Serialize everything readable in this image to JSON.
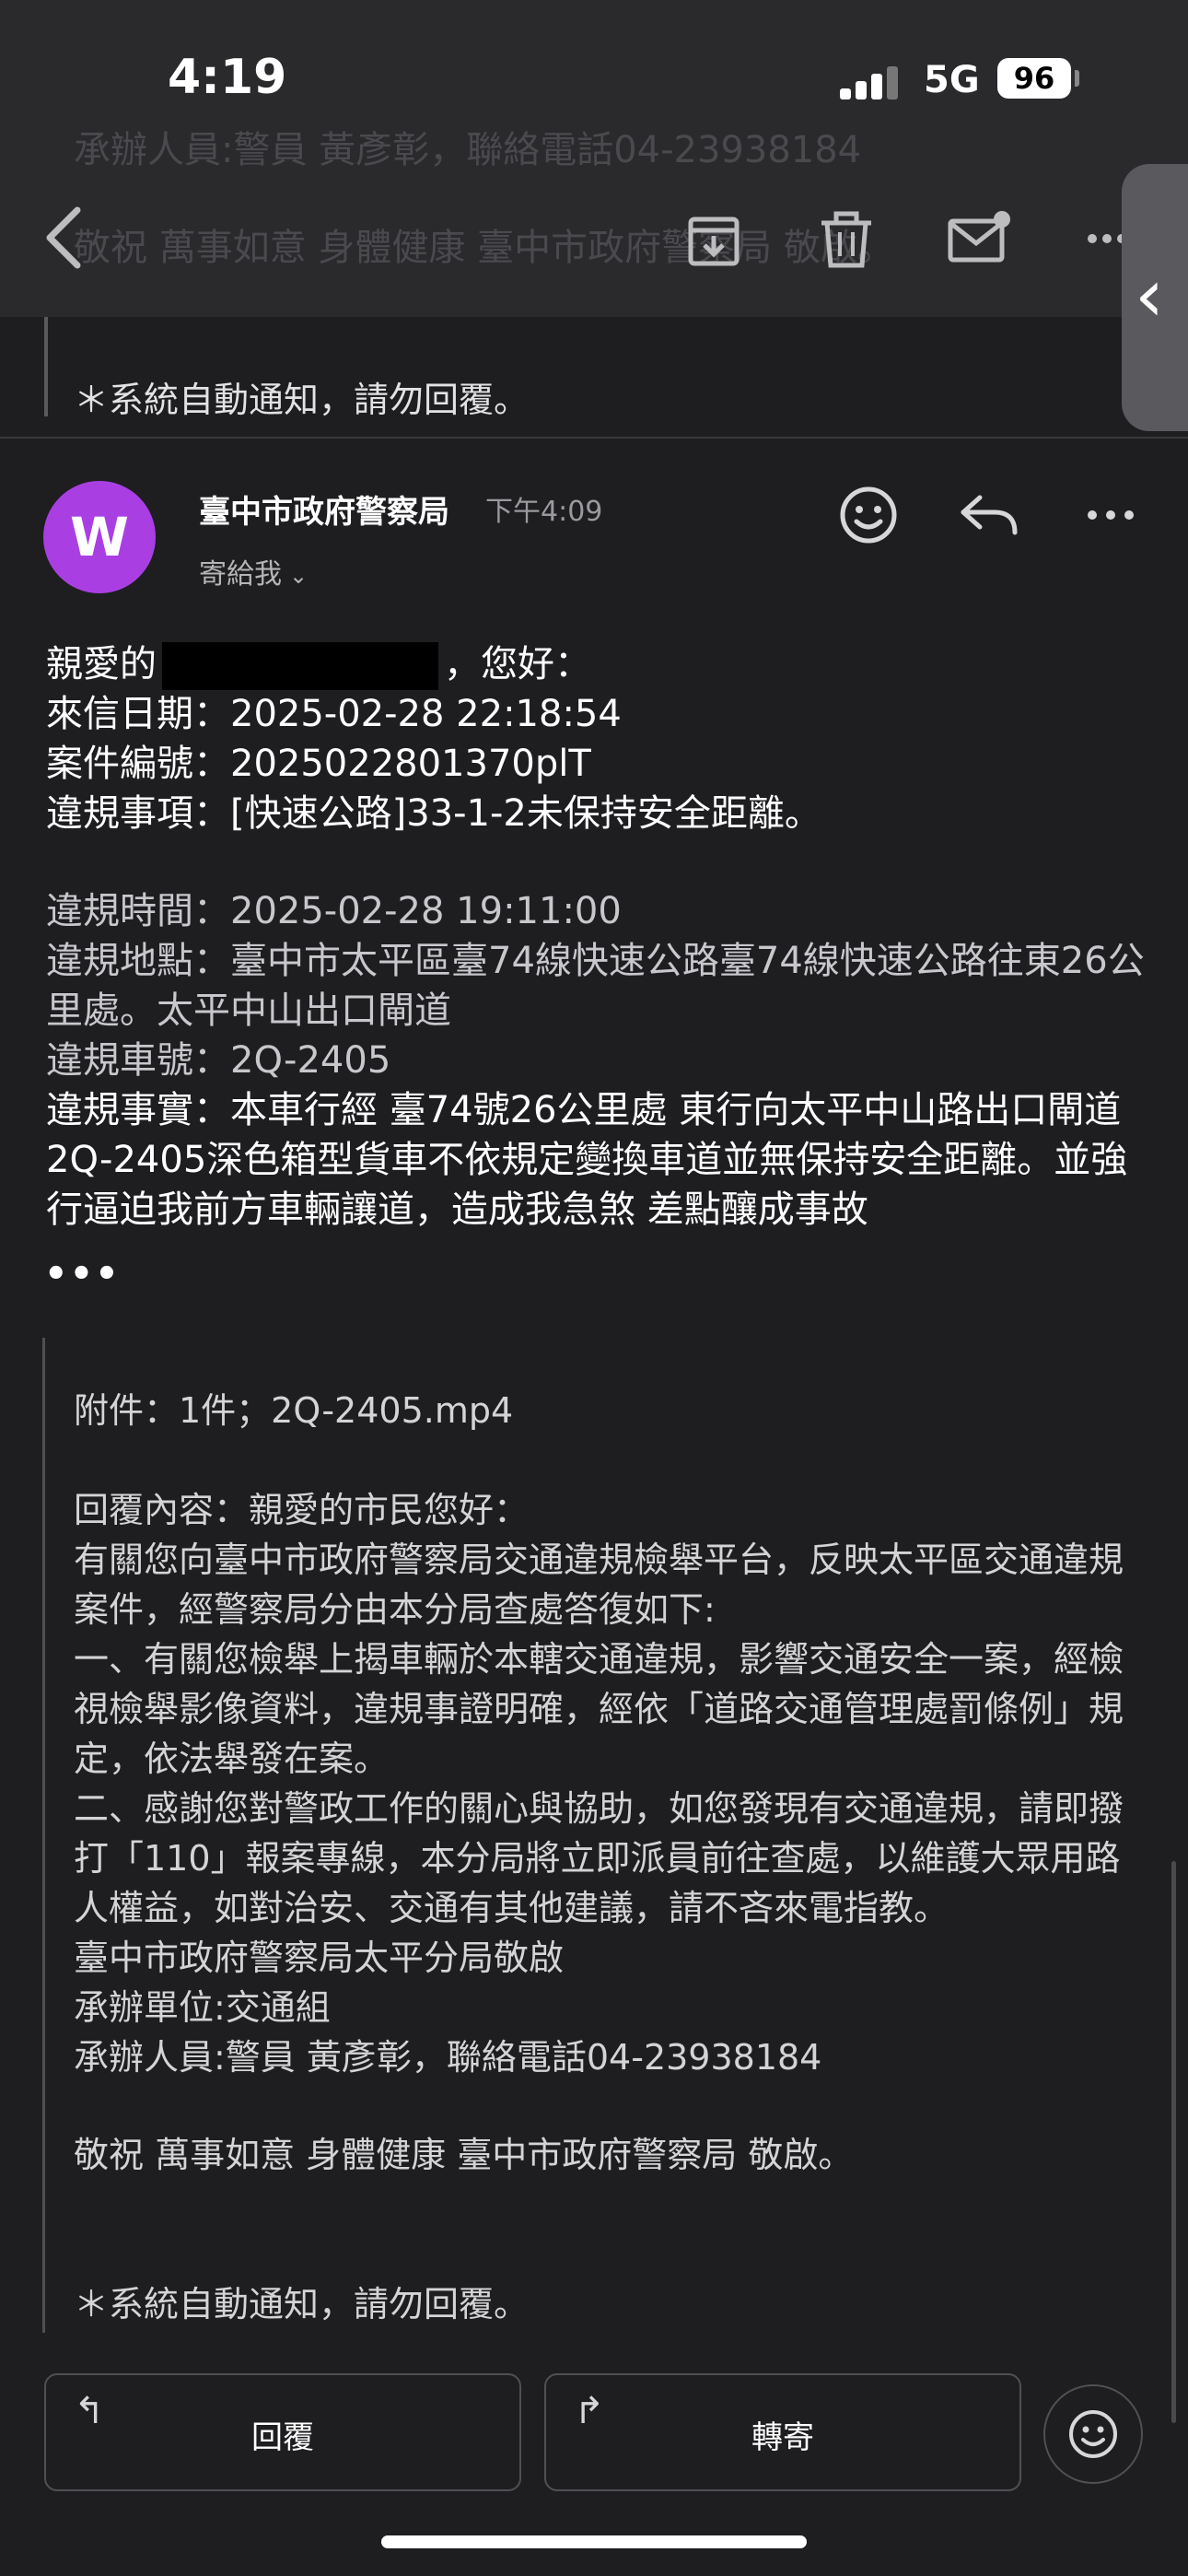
{
  "status": {
    "time": "4:19",
    "network": "5G",
    "battery": "96"
  },
  "toolbar": {
    "back_icon": "chevron-left-icon",
    "archive_icon": "archive-icon",
    "delete_icon": "trash-icon",
    "mark_unread_icon": "mail-unread-icon",
    "more_icon": "more-horizontal-icon",
    "ghost_line_1": "承辦人員:警員 黃彥彰，聯絡電話04-23938184",
    "ghost_line_2": "敬祝 萬事如意 身體健康 臺中市政府警察局 敬啟。"
  },
  "previous_message": {
    "footer": "＊系統自動通知，請勿回覆。"
  },
  "message": {
    "avatar_letter": "W",
    "avatar_color": "#a93fe3",
    "sender": "臺中市政府警察局",
    "time": "下午4:09",
    "recipient": "寄給我",
    "greeting_prefix": "親愛的",
    "greeting_suffix": "，您好：",
    "date_line": "來信日期：2025-02-28 22:18:54",
    "case_line": "案件編號：2025022801370plT",
    "violation_line": "違規事項：[快速公路]33-1-2未保持安全距離。",
    "detail_time": "違規時間：2025-02-28 19:11:00",
    "detail_place": "違規地點：臺中市太平區臺74線快速公路臺74線快速公路往東26公里處。太平中山出口閘道",
    "detail_plate": "違規車號：2Q-2405",
    "detail_fact": "違規事實：本車行經 臺74號26公里處 東行向太平中山路出口閘道2Q-2405深色箱型貨車不依規定變換車道並無保持安全距離。並強行逼迫我前方車輛讓道，造成我急煞 差點釀成事故",
    "ellipsis": "•••"
  },
  "quoted": {
    "attachment": "附件：1件；2Q-2405.mp4",
    "reply_heading": "回覆內容：親愛的市民您好：",
    "reply_p1": "有關您向臺中市政府警察局交通違規檢舉平台，反映太平區交通違規案件，經警察局分由本分局查處答復如下:",
    "reply_p2": "一、有關您檢舉上揭車輛於本轄交通違規，影響交通安全一案，經檢視檢舉影像資料，違規事證明確，經依「道路交通管理處罰條例」規定，依法舉發在案。",
    "reply_p3": "二、感謝您對警政工作的關心與協助，如您發現有交通違規，請即撥打「110」報案專線，本分局將立即派員前往查處，以維護大眾用路人權益，如對治安、交通有其他建議，請不吝來電指教。",
    "signoff_org": "臺中市政府警察局太平分局敬啟",
    "unit": "承辦單位:交通組",
    "officer": "承辦人員:警員 黃彥彰，聯絡電話04-23938184",
    "regards": "敬祝 萬事如意 身體健康 臺中市政府警察局 敬啟。",
    "footer": "＊系統自動通知，請勿回覆。"
  },
  "actions": {
    "reply_label": "回覆",
    "forward_label": "轉寄"
  }
}
